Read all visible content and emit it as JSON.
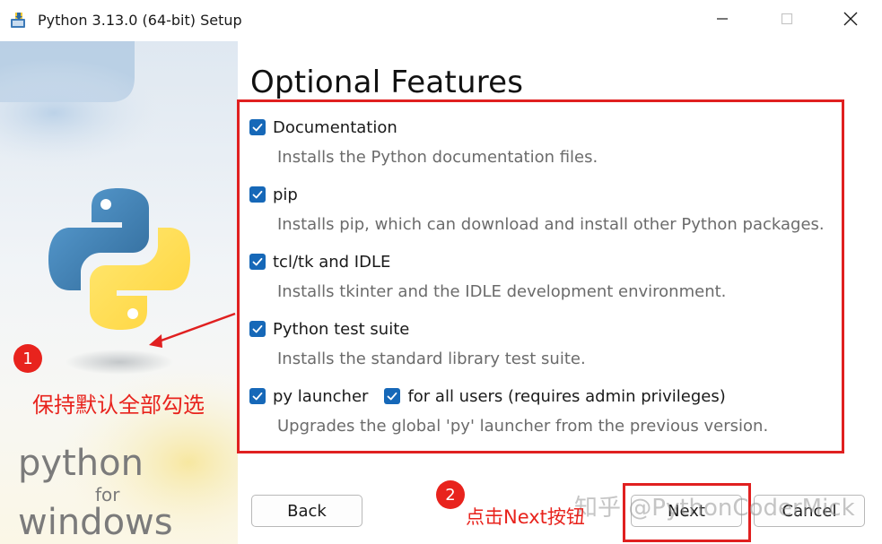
{
  "window": {
    "title": "Python 3.13.0 (64-bit) Setup",
    "controls": {
      "minimize": "minimize",
      "maximize": "maximize",
      "close": "close"
    }
  },
  "side_panel": {
    "logo_text_1": "python",
    "logo_text_2": "for",
    "logo_text_3": "windows"
  },
  "page": {
    "heading": "Optional Features",
    "features": [
      {
        "label": "Documentation",
        "checked": true,
        "description": "Installs the Python documentation files."
      },
      {
        "label": "pip",
        "checked": true,
        "description": "Installs pip, which can download and install other Python packages."
      },
      {
        "label": "tcl/tk and IDLE",
        "checked": true,
        "description": "Installs tkinter and the IDLE development environment."
      },
      {
        "label": "Python test suite",
        "checked": true,
        "description": "Installs the standard library test suite."
      },
      {
        "label": "py launcher",
        "checked": true,
        "description": "Upgrades the global 'py' launcher from the previous version."
      }
    ],
    "for_all_users": {
      "label": "for all users (requires admin privileges)",
      "checked": true
    }
  },
  "buttons": {
    "back": "Back",
    "next": "Next",
    "cancel": "Cancel"
  },
  "annotations": {
    "badge_1": "1",
    "badge_2": "2",
    "note_1": "保持默认全部勾选",
    "note_2": "点击Next按钮",
    "watermark": "知乎 @PythonCoderMick"
  },
  "colors": {
    "accent": "#1668b8",
    "annotation_red": "#e02020"
  }
}
